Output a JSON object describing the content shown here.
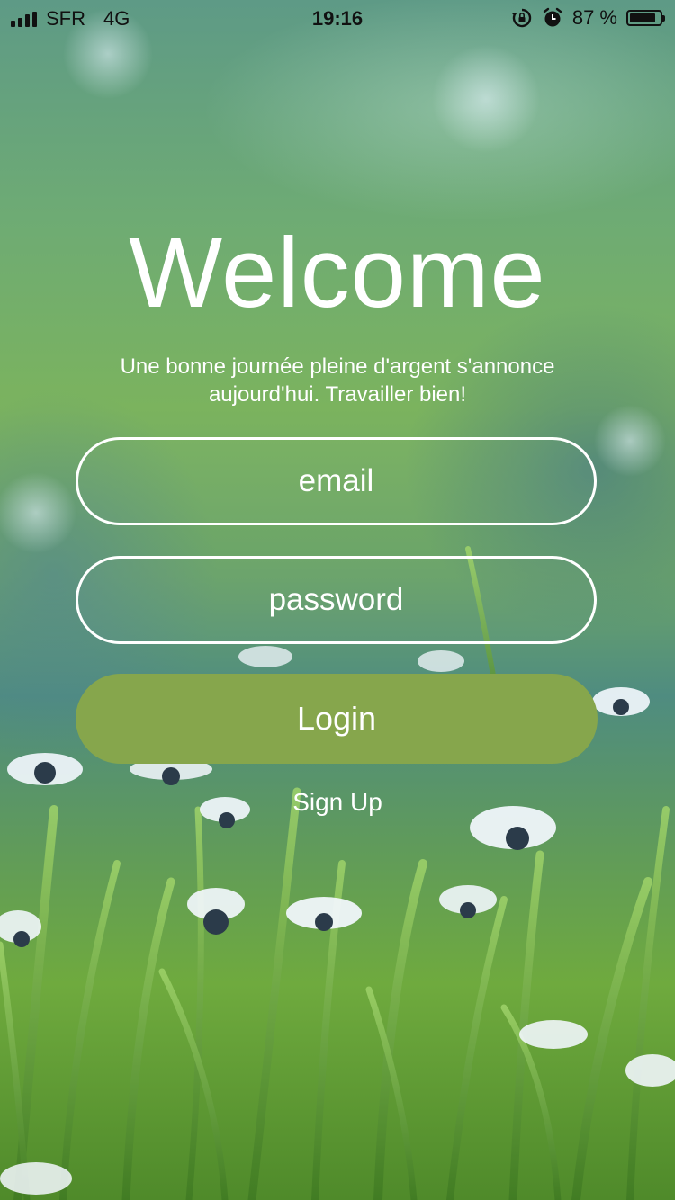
{
  "status_bar": {
    "carrier": "SFR",
    "network": "4G",
    "time": "19:16",
    "battery_text": "87 %",
    "battery_level": 0.87,
    "icons": [
      "signal-icon",
      "rotation-lock-icon",
      "alarm-icon",
      "battery-icon"
    ]
  },
  "welcome": {
    "title": "Welcome",
    "subtitle": "Une bonne journée pleine d'argent s'annonce aujourd'hui. Travailler bien!"
  },
  "form": {
    "email_placeholder": "email",
    "password_placeholder": "password",
    "login_label": "Login",
    "signup_label": "Sign Up"
  },
  "colors": {
    "login_button": "#86a64c",
    "field_border": "#ffffff",
    "text": "#ffffff"
  }
}
